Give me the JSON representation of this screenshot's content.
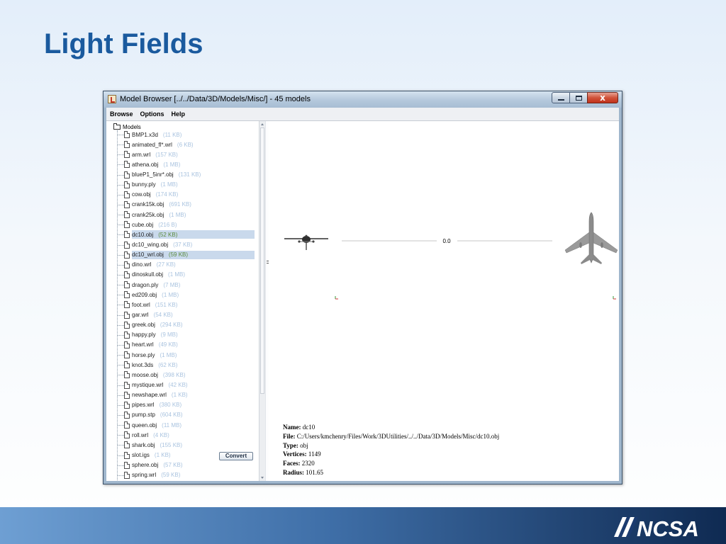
{
  "slide": {
    "title": "Light Fields",
    "logo_text": "NCSA"
  },
  "window": {
    "title": "Model Browser [../../Data/3D/Models/Misc/] - 45 models",
    "close_glyph": "x"
  },
  "menu": [
    "Browse",
    "Options",
    "Help"
  ],
  "tree": {
    "root_label": "Models",
    "items": [
      {
        "name": "BMP1.x3d",
        "size": "(11 KB)"
      },
      {
        "name": "animated_fl*.wrl",
        "size": "(6 KB)"
      },
      {
        "name": "arm.wrl",
        "size": "(157 KB)"
      },
      {
        "name": "athena.obj",
        "size": "(1 MB)"
      },
      {
        "name": "blueP1_5inr*.obj",
        "size": "(131 KB)"
      },
      {
        "name": "bunny.ply",
        "size": "(1 MB)"
      },
      {
        "name": "cow.obj",
        "size": "(174 KB)"
      },
      {
        "name": "crank15k.obj",
        "size": "(691 KB)"
      },
      {
        "name": "crank25k.obj",
        "size": "(1 MB)"
      },
      {
        "name": "cube.obj",
        "size": "(216 B)"
      },
      {
        "name": "dc10.obj",
        "size": "(52 KB)"
      },
      {
        "name": "dc10_wing.obj",
        "size": "(37 KB)"
      },
      {
        "name": "dc10_wrl.obj",
        "size": "(59 KB)"
      },
      {
        "name": "dino.wrl",
        "size": "(27 KB)"
      },
      {
        "name": "dinoskull.obj",
        "size": "(1 MB)"
      },
      {
        "name": "dragon.ply",
        "size": "(7 MB)"
      },
      {
        "name": "ed209.obj",
        "size": "(1 MB)"
      },
      {
        "name": "foot.wrl",
        "size": "(151 KB)"
      },
      {
        "name": "gar.wrl",
        "size": "(54 KB)"
      },
      {
        "name": "greek.obj",
        "size": "(294 KB)"
      },
      {
        "name": "happy.ply",
        "size": "(9 MB)"
      },
      {
        "name": "heart.wrl",
        "size": "(49 KB)"
      },
      {
        "name": "horse.ply",
        "size": "(1 MB)"
      },
      {
        "name": "knot.3ds",
        "size": "(62 KB)"
      },
      {
        "name": "moose.obj",
        "size": "(398 KB)"
      },
      {
        "name": "mystique.wrl",
        "size": "(42 KB)"
      },
      {
        "name": "newshape.wrl",
        "size": "(1 KB)"
      },
      {
        "name": "pipes.wrl",
        "size": "(380 KB)"
      },
      {
        "name": "pump.stp",
        "size": "(604 KB)"
      },
      {
        "name": "queen.obj",
        "size": "(11 MB)"
      },
      {
        "name": "roll.wrl",
        "size": "(4 KB)"
      },
      {
        "name": "shark.obj",
        "size": "(155 KB)"
      },
      {
        "name": "slot.igs",
        "size": "(1 KB)"
      },
      {
        "name": "sphere.obj",
        "size": "(57 KB)"
      },
      {
        "name": "spring.wrl",
        "size": "(59 KB)"
      }
    ],
    "selected": [
      "dc10.obj",
      "dc10_wrl.obj"
    ],
    "convert_label": "Convert"
  },
  "viewer": {
    "distance_label": "0.0",
    "info": {
      "name_label": "Name:",
      "name_value": "dc10",
      "file_label": "File:",
      "file_value": "C:/Users/kmchenry/Files/Work/3DUtilities/../../Data/3D/Models/Misc/dc10.obj",
      "type_label": "Type:",
      "type_value": "obj",
      "vertices_label": "Vertices:",
      "vertices_value": "1149",
      "faces_label": "Faces:",
      "faces_value": "2320",
      "radius_label": "Radius:",
      "radius_value": "101.65"
    }
  },
  "colors": {
    "title": "#1a5a9e",
    "selection": "#c9d9ec",
    "size_text": "#a9c3df",
    "selected_size_text": "#5a8a3c"
  }
}
